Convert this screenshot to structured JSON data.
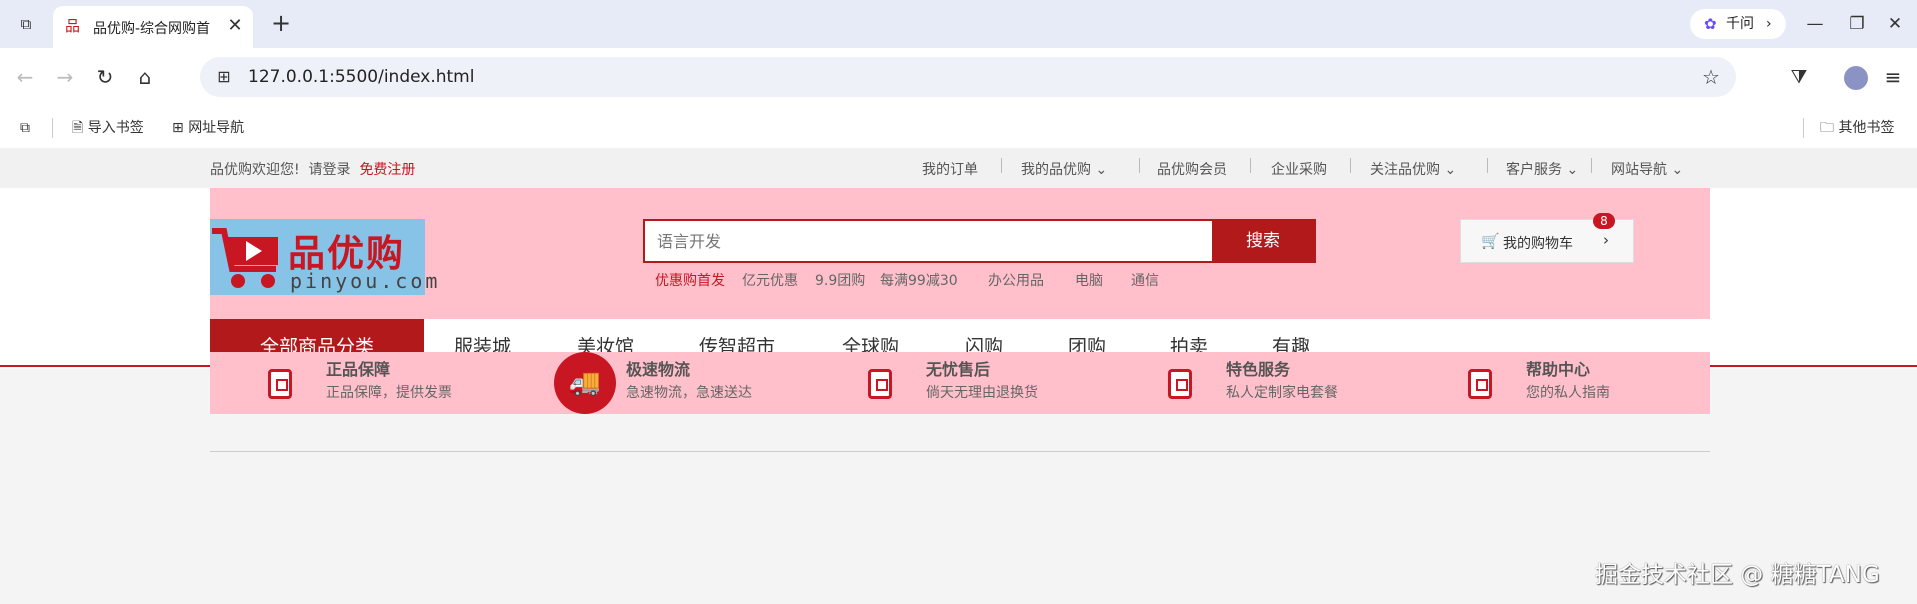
{
  "browser": {
    "tab_title": "品优购-综合网购首",
    "tab_close": "✕",
    "new_tab": "+",
    "assistant_label": "千问",
    "url": "127.0.0.1:5500/index.html",
    "bookmarks": {
      "import": "导入书签",
      "nav": "网址导航",
      "other": "其他书签"
    }
  },
  "shortcut": {
    "welcome": "品优购欢迎您!",
    "login": "请登录",
    "register": "免费注册",
    "links": [
      "我的订单",
      "我的品优购",
      "品优购会员",
      "企业采购",
      "关注品优购",
      "客户服务",
      "网站导航"
    ]
  },
  "header": {
    "logo_text": "品优购",
    "logo_sub": "pinyou.com",
    "search_placeholder": "语言开发",
    "search_button": "搜索",
    "hotwords": [
      "优惠购首发",
      "亿元优惠",
      "9.9团购",
      "每满99减30",
      "办公用品",
      "电脑",
      "通信"
    ],
    "cart_label": "我的购物车",
    "cart_count": "8"
  },
  "nav": {
    "all_categories": "全部商品分类",
    "items": [
      "服装城",
      "美妆馆",
      "传智超市",
      "全球购",
      "闪购",
      "团购",
      "拍卖",
      "有趣"
    ]
  },
  "services": [
    {
      "title": "正品保障",
      "desc": "正品保障，提供发票"
    },
    {
      "title": "极速物流",
      "desc": "急速物流，急速送达"
    },
    {
      "title": "无忧售后",
      "desc": "倘天无理由退换货"
    },
    {
      "title": "特色服务",
      "desc": "私人定制家电套餐"
    },
    {
      "title": "帮助中心",
      "desc": "您的私人指南"
    }
  ],
  "watermark": "掘金技术社区 @ 糖糖TANG",
  "colors": {
    "brand_red": "#c81623",
    "header_pink": "#ffc0cb"
  }
}
